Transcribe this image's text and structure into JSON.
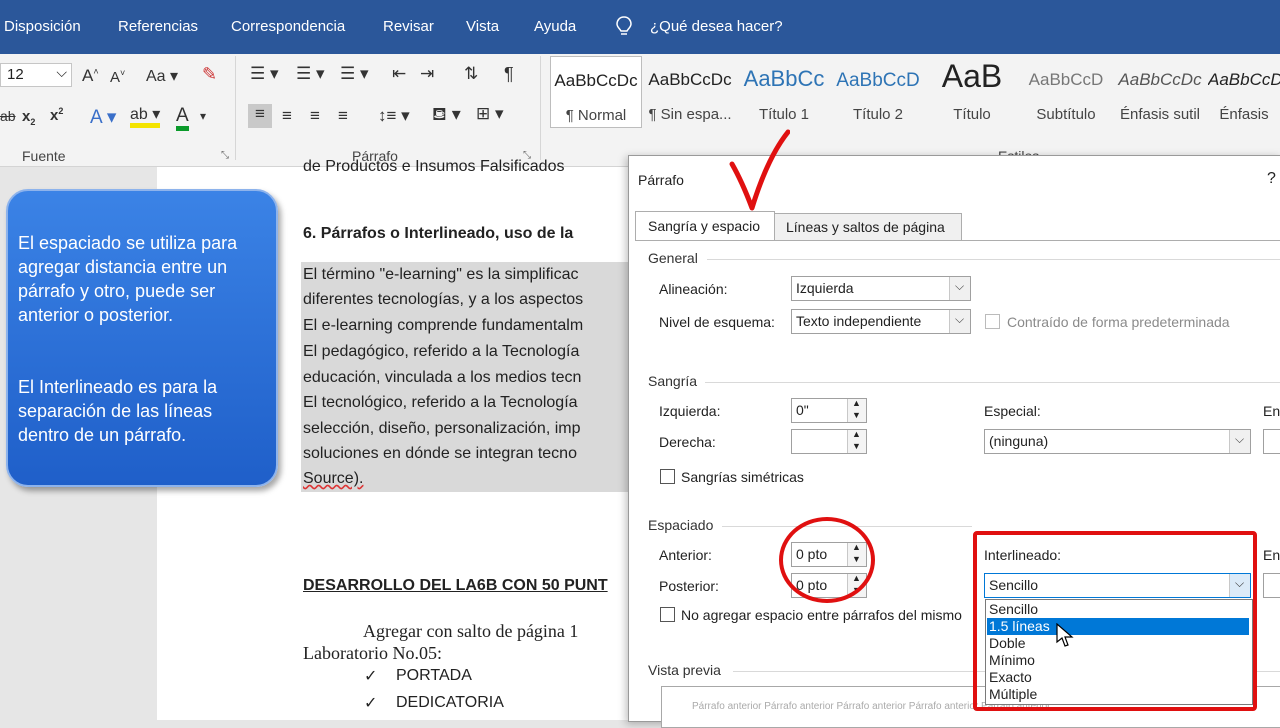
{
  "ribbon": {
    "tabs": [
      "Disposición",
      "Referencias",
      "Correspondencia",
      "Revisar",
      "Vista",
      "Ayuda",
      "¿Qué desea hacer?"
    ],
    "font_size": "12",
    "groups": {
      "font": "Fuente",
      "paragraph": "Párrafo",
      "styles": "Estilos"
    },
    "styles": [
      {
        "preview": "AaBbCcDc",
        "name": "¶ Normal"
      },
      {
        "preview": "AaBbCcDc",
        "name": "¶ Sin espa..."
      },
      {
        "preview": "AaBbCc",
        "name": "Título 1"
      },
      {
        "preview": "AaBbCcD",
        "name": "Título 2"
      },
      {
        "preview": "AaB",
        "name": "Título"
      },
      {
        "preview": "AaBbCcD",
        "name": "Subtítulo"
      },
      {
        "preview": "AaBbCcDc",
        "name": "Énfasis sutil"
      },
      {
        "preview": "AaBbCcDc",
        "name": "Énfasis"
      }
    ],
    "accent": "#2b579a"
  },
  "callout": {
    "para1": "El espaciado se utiliza para agregar distancia entre un párrafo y otro, puede ser anterior o posterior.",
    "para2": "El Interlineado es para la separación de las líneas dentro de un párrafo."
  },
  "document": {
    "top_line": "de Productos e Insumos Falsificados",
    "heading": "6.   Párrafos o Interlineado, uso de la",
    "body_lines": [
      "El término \"e-learning\" es la simplificac",
      "diferentes tecnologías, y a los aspectos",
      "El e-learning comprende fundamentalm",
      "El pedagógico, referido a la Tecnología",
      "educación, vinculada a los medios tecn",
      "El tecnológico, referido a la Tecnología",
      "selección, diseño, personalización, imp",
      "soluciones en dónde se integran tecno",
      "Source)."
    ],
    "section_title": "DESARROLLO DEL LA6B CON 50 PUNT",
    "para_line1": "Agregar con salto de página 1",
    "para_line2": "Laboratorio No.05:",
    "checklist": [
      "PORTADA",
      "DEDICATORIA"
    ]
  },
  "dialog": {
    "title": "Párrafo",
    "help": "?",
    "tabs": [
      "Sangría y espacio",
      "Líneas y saltos de página"
    ],
    "general": {
      "section": "General",
      "alignment_label": "Alineación:",
      "alignment_value": "Izquierda",
      "outline_label": "Nivel de esquema:",
      "outline_value": "Texto independiente",
      "collapsed_label": "Contraído de forma predeterminada"
    },
    "indent": {
      "section": "Sangría",
      "left_label": "Izquierda:",
      "left_value": "0\"",
      "right_label": "Derecha:",
      "right_value": "",
      "special_label": "Especial:",
      "special_value": "(ninguna)",
      "by_label": "En",
      "mirror_label": "Sangrías simétricas"
    },
    "spacing": {
      "section": "Espaciado",
      "before_label": "Anterior:",
      "before_value": "0 pto",
      "after_label": "Posterior:",
      "after_value": "0 pto",
      "line_label": "Interlineado:",
      "line_value": "Sencillo",
      "at_label": "En",
      "no_space_label": "No agregar espacio entre párrafos del mismo",
      "options": [
        "Sencillo",
        "1.5 líneas",
        "Doble",
        "Mínimo",
        "Exacto",
        "Múltiple"
      ],
      "selected_option": "1.5 líneas"
    },
    "preview": {
      "section": "Vista previa",
      "text": "Párrafo anterior Párrafo anterior Párrafo anterior Párrafo anterior Párrafo anterior"
    }
  },
  "annotation_color": "#e01010"
}
